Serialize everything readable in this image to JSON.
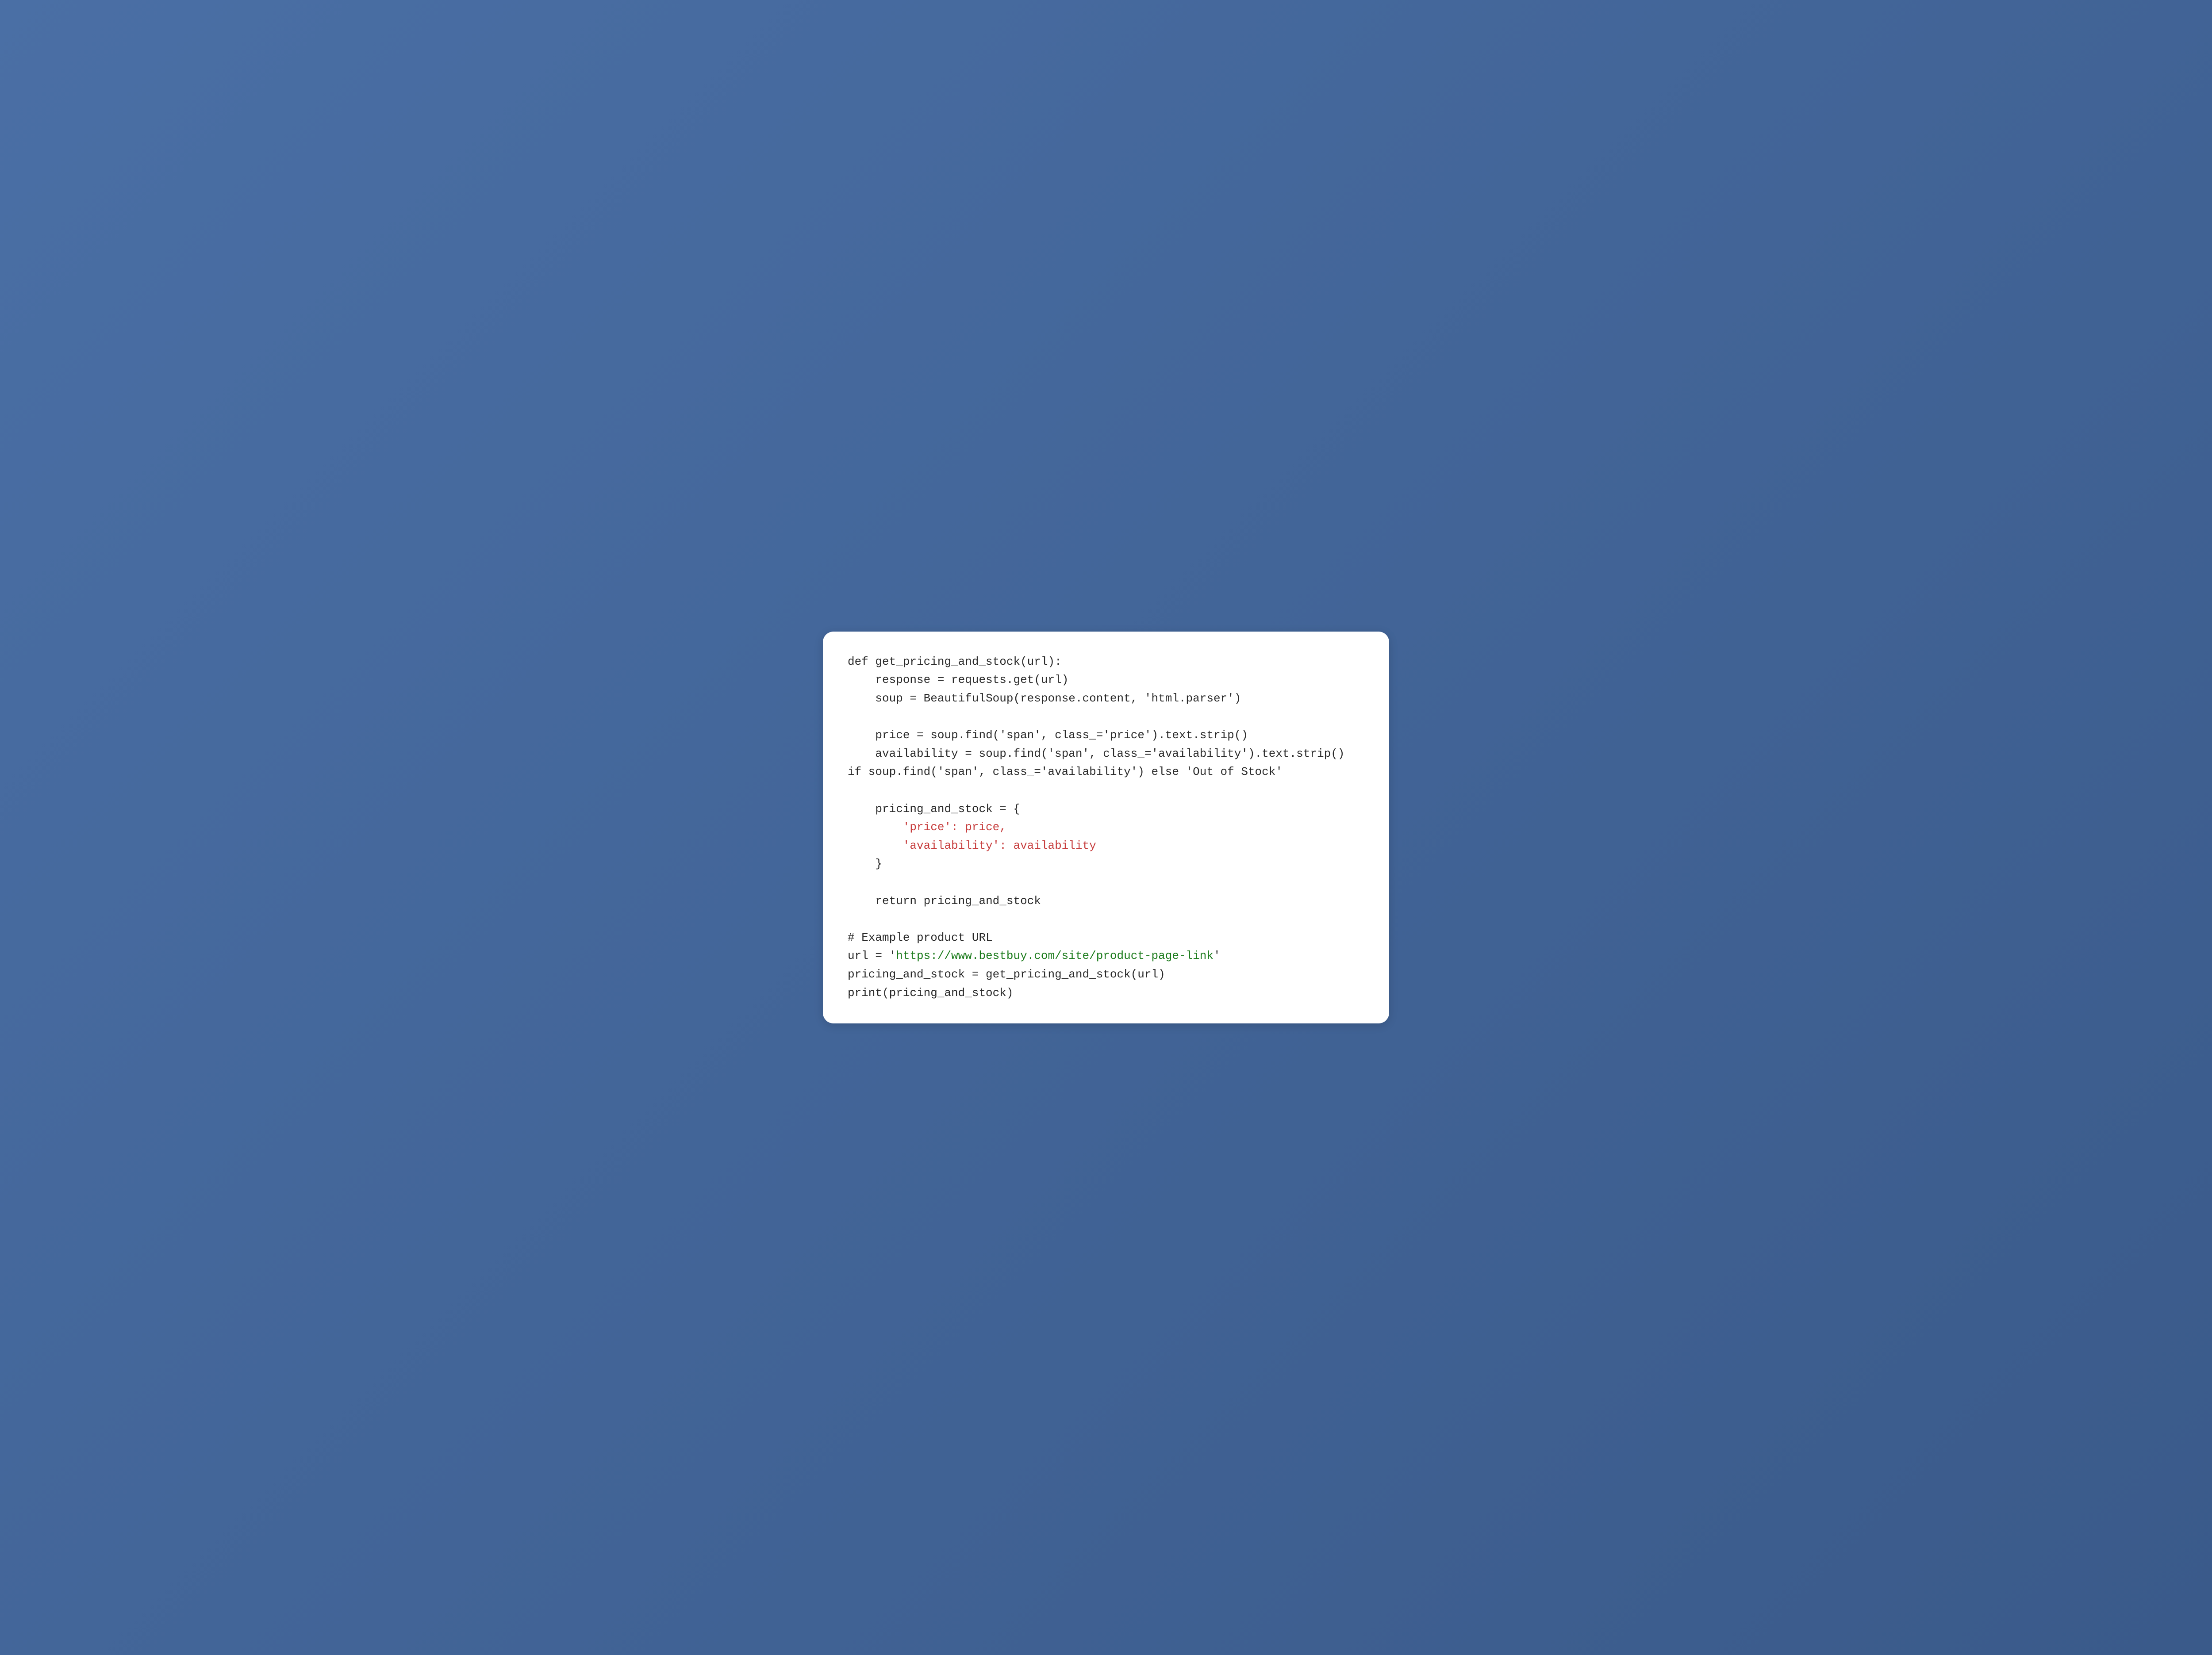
{
  "code": {
    "tokens": [
      {
        "text": "def get_pricing_and_stock(url):\n",
        "cls": "tok-default"
      },
      {
        "text": "    response = requests.get(url)\n",
        "cls": "tok-default"
      },
      {
        "text": "    soup = BeautifulSoup(response.content, 'html.parser')\n",
        "cls": "tok-default"
      },
      {
        "text": "\n",
        "cls": "tok-default"
      },
      {
        "text": "    price = soup.find('span', class_='price').text.strip()\n",
        "cls": "tok-default"
      },
      {
        "text": "    availability = soup.find('span', class_='availability').text.strip() if soup.find('span', class_='availability') else 'Out of Stock'\n",
        "cls": "tok-default"
      },
      {
        "text": "\n",
        "cls": "tok-default"
      },
      {
        "text": "    pricing_and_stock = {\n",
        "cls": "tok-default"
      },
      {
        "text": "        ",
        "cls": "tok-default"
      },
      {
        "text": "'price': price,",
        "cls": "tok-string"
      },
      {
        "text": "\n",
        "cls": "tok-default"
      },
      {
        "text": "        ",
        "cls": "tok-default"
      },
      {
        "text": "'availability': availability",
        "cls": "tok-string"
      },
      {
        "text": "\n",
        "cls": "tok-default"
      },
      {
        "text": "    }\n",
        "cls": "tok-default"
      },
      {
        "text": "\n",
        "cls": "tok-default"
      },
      {
        "text": "    return pricing_and_stock\n",
        "cls": "tok-default"
      },
      {
        "text": "\n",
        "cls": "tok-default"
      },
      {
        "text": "# Example product URL\n",
        "cls": "tok-default"
      },
      {
        "text": "url = '",
        "cls": "tok-default"
      },
      {
        "text": "https://www.bestbuy.com/site/product-page-link",
        "cls": "tok-url"
      },
      {
        "text": "'\n",
        "cls": "tok-default"
      },
      {
        "text": "pricing_and_stock = get_pricing_and_stock(url)\n",
        "cls": "tok-default"
      },
      {
        "text": "print(pricing_and_stock)",
        "cls": "tok-default"
      }
    ]
  }
}
